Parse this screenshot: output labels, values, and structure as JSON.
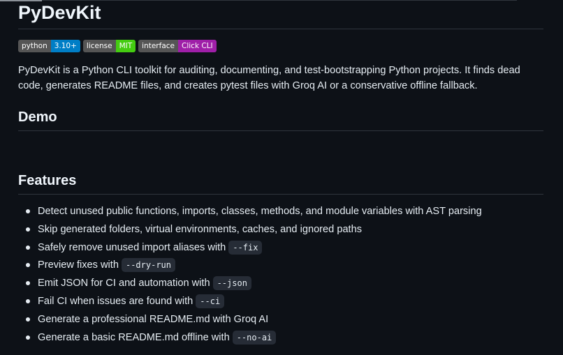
{
  "readme": {
    "title": "PyDevKit",
    "badges": [
      {
        "label": "python",
        "value": "3.10+",
        "color": "#007ec6"
      },
      {
        "label": "license",
        "value": "MIT",
        "color": "#4c1"
      },
      {
        "label": "interface",
        "value": "Click CLI",
        "color": "#9f1fa8"
      }
    ],
    "intro": "PyDevKit is a Python CLI toolkit for auditing, documenting, and test-bootstrapping Python projects. It finds dead code, generates README files, and creates pytest files with Groq AI or a conservative offline fallback.",
    "demo_heading": "Demo",
    "features_heading": "Features",
    "features": [
      {
        "text": "Detect unused public functions, imports, classes, methods, and module variables with AST parsing",
        "code": ""
      },
      {
        "text": "Skip generated folders, virtual environments, caches, and ignored paths",
        "code": ""
      },
      {
        "text": "Safely remove unused import aliases with",
        "code": "--fix"
      },
      {
        "text": "Preview fixes with",
        "code": "--dry-run"
      },
      {
        "text": "Emit JSON for CI and automation with",
        "code": "--json"
      },
      {
        "text": "Fail CI when issues are found with",
        "code": "--ci"
      },
      {
        "text": "Generate a professional README.md with Groq AI",
        "code": ""
      },
      {
        "text": "Generate a basic README.md offline with",
        "code": "--no-ai"
      }
    ]
  },
  "colors": {
    "background": "#0d1117",
    "text": "#e6edf3",
    "border": "#30363d",
    "code_bg": "#262c36"
  }
}
